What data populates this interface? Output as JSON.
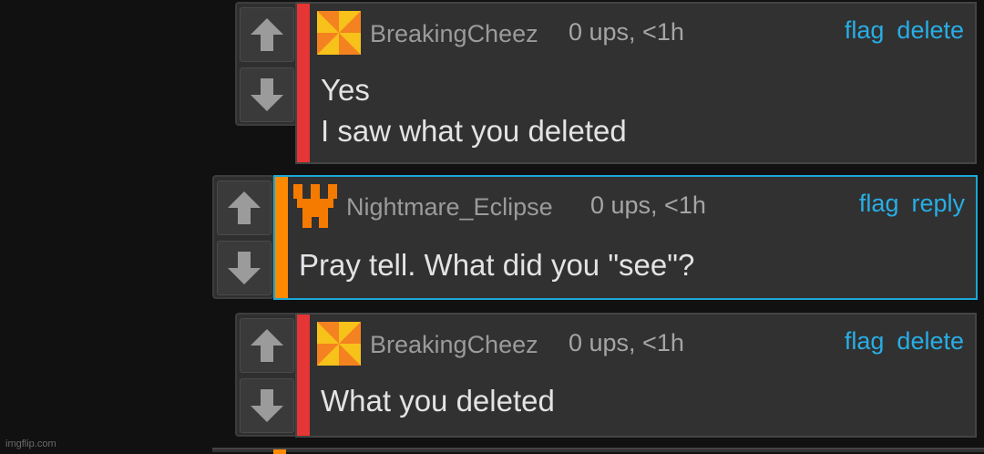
{
  "watermark": "imgflip.com",
  "colors": {
    "background": "#111112",
    "card": "#313132",
    "link": "#28aee4",
    "stripe_red": "#e53535",
    "stripe_orange": "#ff8a00",
    "highlight_border": "#1aa7d6"
  },
  "comments": [
    {
      "author": "BreakingCheez",
      "meta": "0 ups, <1h",
      "actions": [
        "flag",
        "delete"
      ],
      "lines": [
        "Yes",
        "I saw what you deleted"
      ],
      "avatar_icon": "pinwheel-avatar-icon"
    },
    {
      "author": "Nightmare_Eclipse",
      "meta": "0 ups, <1h",
      "actions": [
        "flag",
        "reply"
      ],
      "lines": [
        "Pray tell. What did you \"see\"?"
      ],
      "avatar_icon": "castle-avatar-icon"
    },
    {
      "author": "BreakingCheez",
      "meta": "0 ups, <1h",
      "actions": [
        "flag",
        "delete"
      ],
      "lines": [
        "What you deleted"
      ],
      "avatar_icon": "pinwheel-avatar-icon"
    }
  ]
}
